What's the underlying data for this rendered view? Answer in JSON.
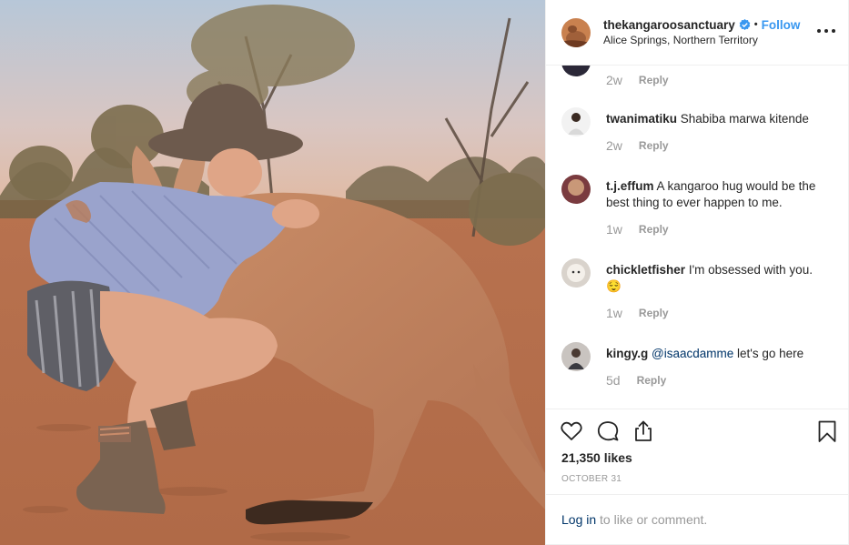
{
  "post": {
    "username": "thekangaroosanctuary",
    "verified_icon": "verified-badge-icon",
    "separator": "•",
    "follow_label": "Follow",
    "location": "Alice Springs, Northern Territory",
    "more_icon": "more-options-icon"
  },
  "comments": [
    {
      "username": "",
      "text": "",
      "time": "2w",
      "reply_label": "Reply"
    },
    {
      "username": "twanimatiku",
      "text": "Shabiba marwa kitende",
      "time": "2w",
      "reply_label": "Reply"
    },
    {
      "username": "t.j.effum",
      "text": "A kangaroo hug would be the best thing to ever happen to me.",
      "time": "1w",
      "reply_label": "Reply"
    },
    {
      "username": "chickletfisher",
      "text": "I'm obsessed with you.",
      "emoji": "😌",
      "time": "1w",
      "reply_label": "Reply"
    },
    {
      "username": "kingy.g",
      "mention": "@isaacdamme",
      "text": "let's go here",
      "time": "5d",
      "reply_label": "Reply"
    }
  ],
  "actions": {
    "like_icon": "heart-icon",
    "comment_icon": "comment-bubble-icon",
    "share_icon": "share-icon",
    "save_icon": "bookmark-icon",
    "likes": "21,350 likes",
    "date": "OCTOBER 31"
  },
  "login": {
    "link_label": "Log in",
    "text": "to like or comment."
  },
  "colors": {
    "accent_blue": "#3897f0",
    "link_dark_blue": "#003569",
    "muted_text": "#999999",
    "border": "#efefef"
  }
}
